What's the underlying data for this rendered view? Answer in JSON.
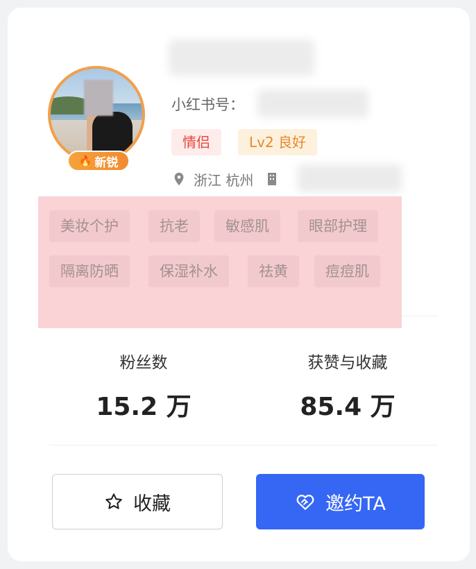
{
  "profile": {
    "avatar_badge": "新锐",
    "red_id_label": "小红书号：",
    "tags": [
      "情侣",
      "Lv2 良好"
    ],
    "location": "浙江 杭州"
  },
  "interests": {
    "row1": [
      "美妆个护",
      "抗老",
      "敏感肌",
      "眼部护理"
    ],
    "row2": [
      "隔离防晒",
      "保湿补水",
      "祛黄",
      "痘痘肌"
    ]
  },
  "stats": {
    "followers_label": "粉丝数",
    "followers_value": "15.2 万",
    "likes_label": "获赞与收藏",
    "likes_value": "85.4 万"
  },
  "actions": {
    "favorite_label": "收藏",
    "invite_label": "邀约TA"
  },
  "colors": {
    "accent_blue": "#3567f4",
    "badge_orange": "#f38a2f",
    "tag_red": "#e8453c",
    "tag_orange": "#e8882a",
    "highlight_pink": "#f9d3d6"
  },
  "icons": {
    "badge": "flame-icon",
    "location": "location-pin-icon",
    "company": "building-icon",
    "favorite": "star-outline-icon",
    "invite": "handshake-heart-icon"
  }
}
